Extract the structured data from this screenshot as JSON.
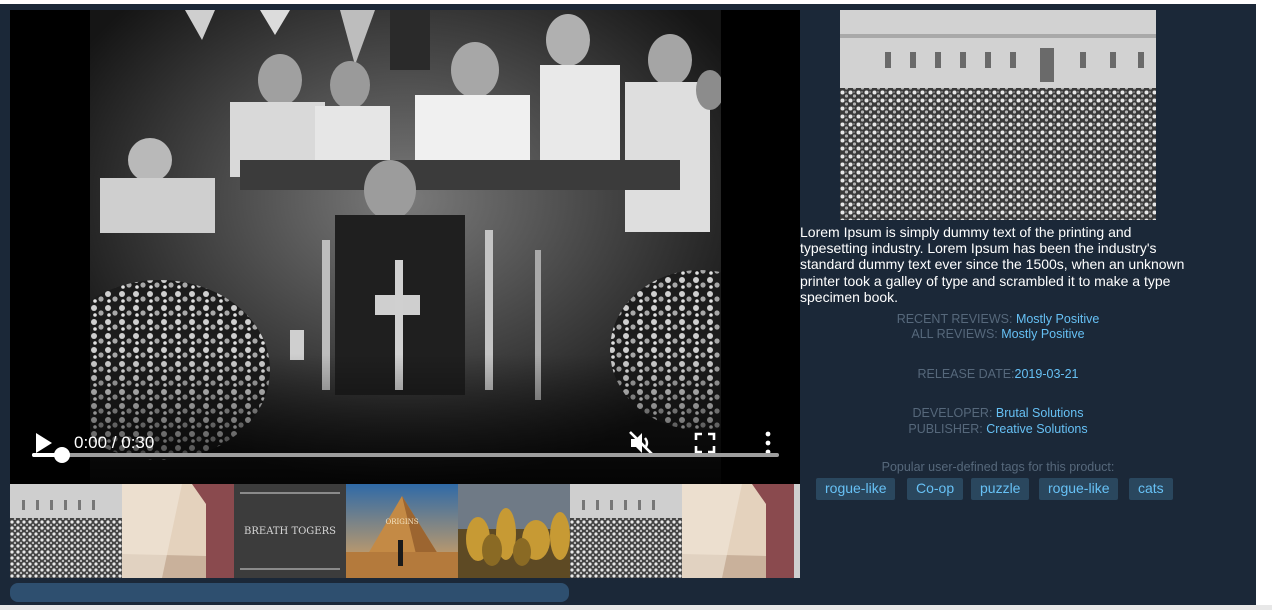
{
  "player": {
    "time_display": "0:00 / 0:30",
    "progress_fraction": 0.04,
    "icons": [
      "play-icon",
      "mute-icon",
      "fullscreen-icon",
      "more-options-icon"
    ]
  },
  "thumbnails": [
    {
      "name": "screenshot-crowd-palace"
    },
    {
      "name": "screenshot-room-corner"
    },
    {
      "name": "screenshot-breath-titles"
    },
    {
      "name": "screenshot-pyramids-game"
    },
    {
      "name": "screenshot-autumn-forest"
    },
    {
      "name": "screenshot-crowd-palace"
    },
    {
      "name": "screenshot-room-corner"
    }
  ],
  "description": "Lorem Ipsum is simply dummy text of the printing and typesetting industry. Lorem Ipsum has been the industry's standard dummy text ever since the 1500s, when an unknown printer took a galley of type and scrambled it to make a type specimen book.",
  "reviews": {
    "recent_label": "RECENT REVIEWS:",
    "recent_value": "Mostly Positive",
    "all_label": "ALL REVIEWS:",
    "all_value": "Mostly Positive"
  },
  "release": {
    "label": "RELEASE DATE:",
    "value": "2019-03-21"
  },
  "developer": {
    "label": "DEVELOPER:",
    "value": "Brutal Solutions"
  },
  "publisher": {
    "label": "PUBLISHER:",
    "value": "Creative Solutions"
  },
  "tags": {
    "title": "Popular user-defined tags for this product:",
    "items": [
      "rogue-like",
      "Co-op",
      "puzzle",
      "rogue-like",
      "cats"
    ]
  },
  "thumbnail_text": {
    "breath_titles": "BREATH TOGERS",
    "pyramids_sign": "ORIGINS"
  },
  "colors": {
    "background": "#1b2838",
    "link": "#66c0f4",
    "label": "#56687b",
    "tag_bg": "#2a475e",
    "scrollbar": "#2e4f6f"
  }
}
